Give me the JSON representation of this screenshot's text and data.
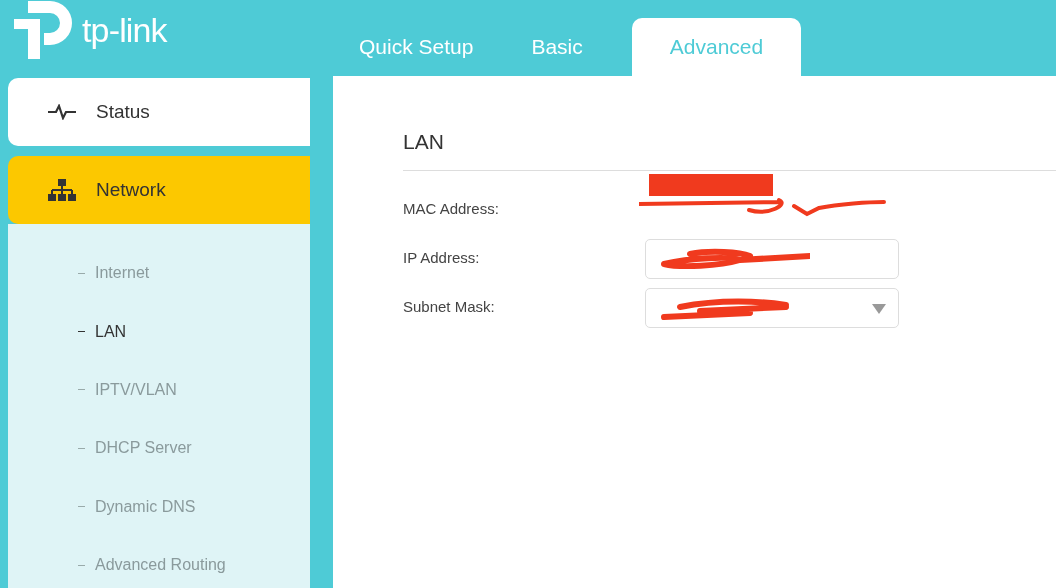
{
  "logo": {
    "text": "tp-link"
  },
  "tabs": [
    {
      "label": "Quick Setup",
      "selected": false
    },
    {
      "label": "Basic",
      "selected": false
    },
    {
      "label": "Advanced",
      "selected": true
    }
  ],
  "sidebar": {
    "items": [
      {
        "label": "Status",
        "kind": "status",
        "selected": false
      },
      {
        "label": "Network",
        "kind": "section",
        "selected": true,
        "children": [
          {
            "label": "Internet",
            "selected": false
          },
          {
            "label": "LAN",
            "selected": true
          },
          {
            "label": "IPTV/VLAN",
            "selected": false
          },
          {
            "label": "DHCP Server",
            "selected": false
          },
          {
            "label": "Dynamic DNS",
            "selected": false
          },
          {
            "label": "Advanced Routing",
            "selected": false
          }
        ]
      }
    ]
  },
  "section": {
    "title": "LAN",
    "fields": [
      {
        "label": "MAC Address:",
        "kind": "text"
      },
      {
        "label": "IP Address:",
        "kind": "input"
      },
      {
        "label": "Subnet Mask:",
        "kind": "select"
      }
    ]
  }
}
